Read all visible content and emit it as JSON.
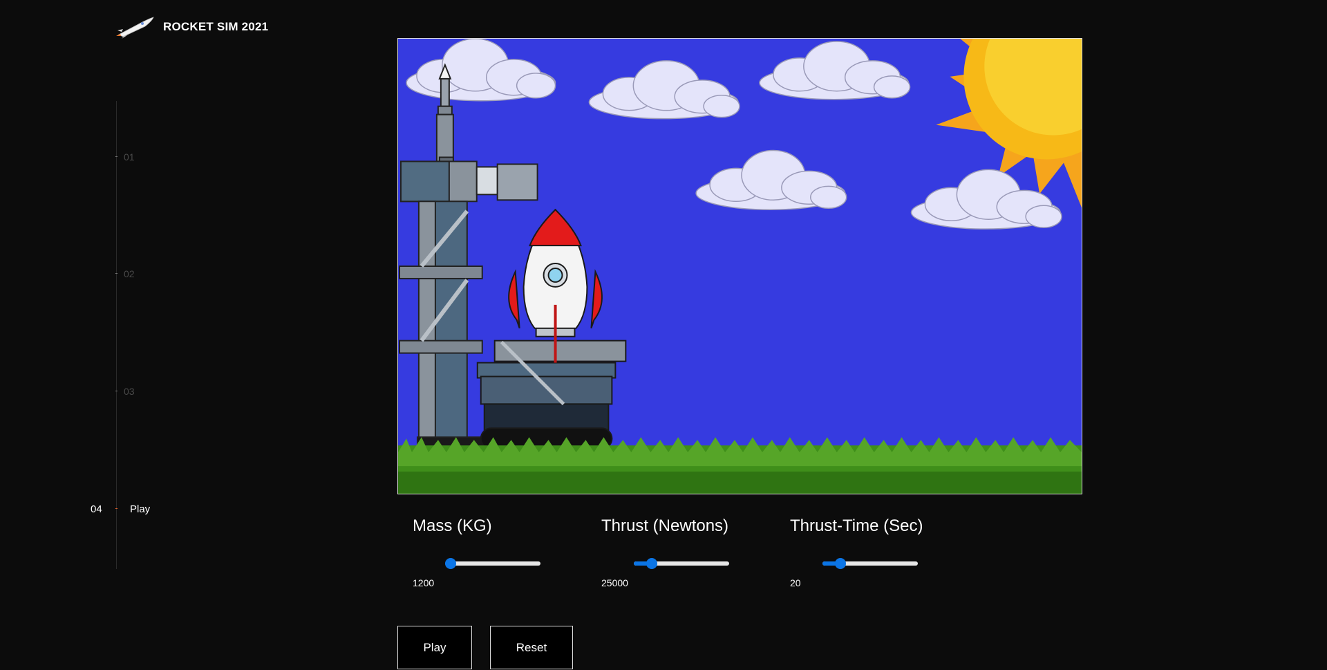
{
  "header": {
    "title": "ROCKET SIM 2021",
    "logo_icon": "rocket-icon"
  },
  "nav": {
    "items": [
      {
        "num": "01",
        "label": ""
      },
      {
        "num": "02",
        "label": ""
      },
      {
        "num": "03",
        "label": ""
      },
      {
        "num": "04",
        "label": "Play",
        "active": true
      }
    ]
  },
  "scene": {
    "elements": [
      "sky",
      "sun-icon",
      "cloud-icon",
      "launch-tower",
      "rocket-icon",
      "grass"
    ],
    "colors": {
      "sky": "#363be0",
      "rocket_accent": "#e31b1b",
      "sun": "#f7b917",
      "grass": "#3f8f1a"
    }
  },
  "controls": [
    {
      "label": "Mass (KG)",
      "value": "1200",
      "fraction": 0.0
    },
    {
      "label": "Thrust (Newtons)",
      "value": "25000",
      "fraction": 0.15
    },
    {
      "label": "Thrust-Time (Sec)",
      "value": "20",
      "fraction": 0.15
    }
  ],
  "buttons": {
    "play": "Play",
    "reset": "Reset"
  },
  "colors": {
    "accent": "#0b75e6",
    "background": "#0c0c0c",
    "active_marker": "#e0602a"
  }
}
